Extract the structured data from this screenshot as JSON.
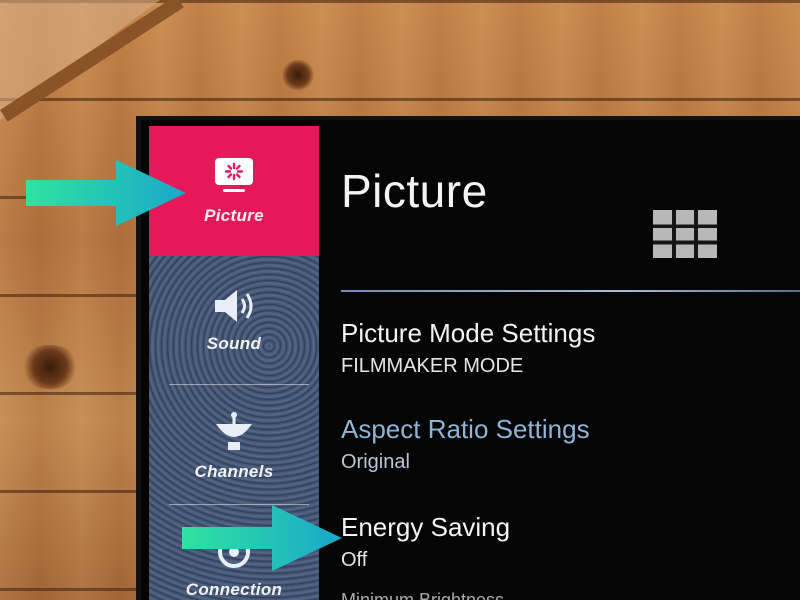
{
  "sidebar": {
    "items": [
      {
        "label": "Picture",
        "icon": "picture-icon",
        "active": true
      },
      {
        "label": "Sound",
        "icon": "speaker-icon",
        "active": false
      },
      {
        "label": "Channels",
        "icon": "satellite-dish-icon",
        "active": false
      },
      {
        "label": "Connection",
        "icon": "connection-icon",
        "active": false
      }
    ]
  },
  "main": {
    "title": "Picture",
    "settings": [
      {
        "name": "Picture Mode Settings",
        "value": "FILMMAKER MODE"
      },
      {
        "name": "Aspect Ratio Settings",
        "value": "Original"
      },
      {
        "name": "Energy Saving",
        "value": "Off"
      },
      {
        "name": "Minimum Brightness",
        "value": ""
      }
    ]
  },
  "colors": {
    "active_menu": "#e5185a",
    "menu_bg": "#3a4a66",
    "screen_bg": "#050505",
    "arrow_start": "#2fe3a0",
    "arrow_end": "#1aa7c9"
  }
}
